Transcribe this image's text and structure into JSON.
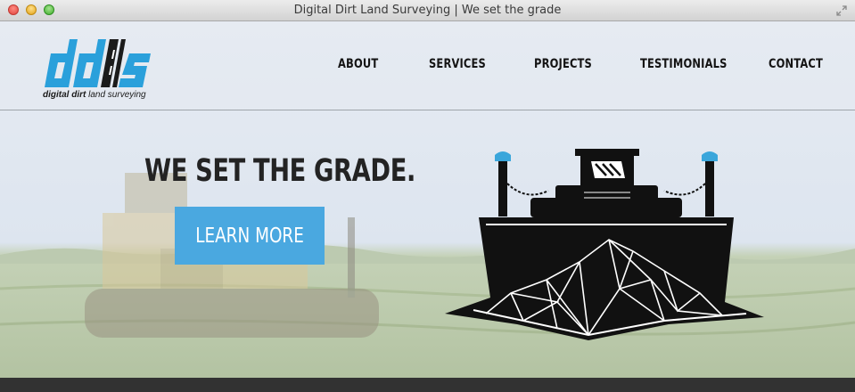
{
  "window": {
    "title": "Digital Dirt Land Surveying | We set the grade"
  },
  "logo": {
    "mark": "dd/s",
    "text_bold": "digital dirt",
    "text_light": "land surveying"
  },
  "nav": {
    "items": [
      "ABOUT",
      "SERVICES",
      "PROJECTS",
      "TESTIMONIALS",
      "CONTACT"
    ]
  },
  "hero": {
    "headline": "WE SET THE GRADE.",
    "cta_label": "LEARN MORE"
  },
  "colors": {
    "accent": "#4aa8e0",
    "nav_text": "#141414",
    "dark": "#232323"
  }
}
